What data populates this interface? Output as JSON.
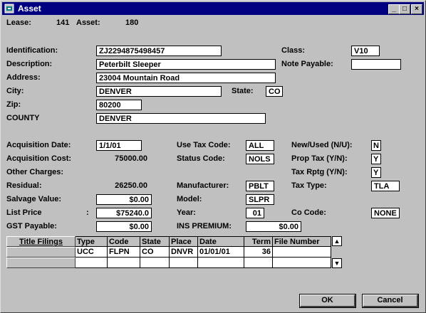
{
  "window": {
    "title": "Asset",
    "min_label": "_",
    "max_label": "□",
    "close_label": "×"
  },
  "header": {
    "lease_label": "Lease:",
    "lease_value": "141",
    "asset_label": "Asset:",
    "asset_value": "180"
  },
  "form": {
    "identification_label": "Identification:",
    "identification_value": "ZJ2294875498457",
    "description_label": "Description:",
    "description_value": "Peterbilt Sleeper",
    "address_label": "Address:",
    "address_value": "23004 Mountain Road",
    "city_label": "City:",
    "city_value": "DENVER",
    "state_label": "State:",
    "state_value": "CO",
    "zip_label": "Zip:",
    "zip_value": "80200",
    "county_label": "COUNTY",
    "county_value": "DENVER",
    "class_label": "Class:",
    "class_value": "V10",
    "note_payable_label": "Note Payable:",
    "note_payable_value": "",
    "acq_date_label": "Acquisition Date:",
    "acq_date_value": "1/1/01",
    "acq_cost_label": "Acquisition Cost:",
    "acq_cost_value": "75000.00",
    "other_charges_label": "Other Charges:",
    "residual_label": "Residual:",
    "residual_value": "26250.00",
    "salvage_label": "Salvage Value:",
    "salvage_value": "$0.00",
    "list_price_label": "List Price",
    "list_price_colon": ":",
    "list_price_value": "$75240.0",
    "gst_label": "GST Payable:",
    "gst_value": "$0.00",
    "use_tax_label": "Use Tax Code:",
    "use_tax_value": "ALL",
    "status_code_label": "Status Code:",
    "status_code_value": "NOLS",
    "manufacturer_label": "Manufacturer:",
    "manufacturer_value": "PBLT",
    "model_label": "Model:",
    "model_value": "SLPR",
    "year_label": "Year:",
    "year_value": "01",
    "ins_premium_label": "INS PREMIUM:",
    "ins_premium_value": "$0.00",
    "new_used_label": "New/Used (N/U):",
    "new_used_value": "N",
    "prop_tax_label": "Prop Tax (Y/N):",
    "prop_tax_value": "Y",
    "tax_rptg_label": "Tax Rptg (Y/N):",
    "tax_rptg_value": "Y",
    "tax_type_label": "Tax Type:",
    "tax_type_value": "TLA",
    "co_code_label": "Co Code:",
    "co_code_value": "NONE"
  },
  "grid": {
    "row_header": "Title Filings",
    "columns": [
      "Type",
      "Code",
      "State",
      "Place",
      "Date",
      "Term",
      "File Number"
    ],
    "rows": [
      [
        "UCC",
        "FLPN",
        "CO",
        "DNVR",
        "01/01/01",
        "36",
        ""
      ]
    ]
  },
  "buttons": {
    "ok": "OK",
    "cancel": "Cancel"
  }
}
